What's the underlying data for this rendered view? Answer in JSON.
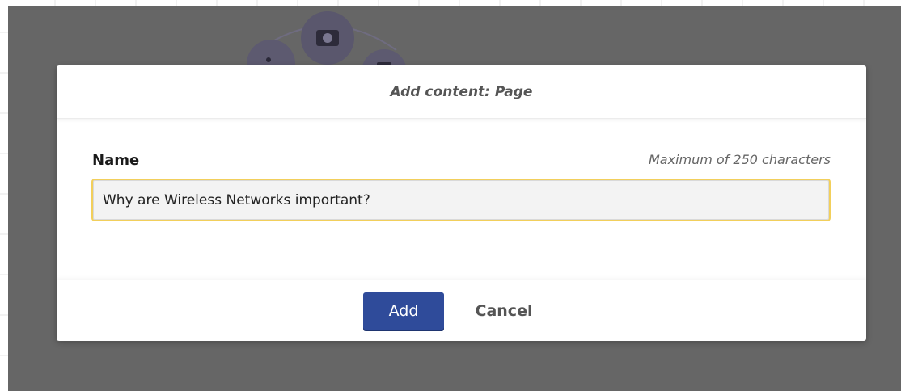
{
  "dialog": {
    "title": "Add content: Page",
    "field_label": "Name",
    "field_hint": "Maximum of 250 characters",
    "name_value": "Why are Wireless Networks important?",
    "add_label": "Add",
    "cancel_label": "Cancel"
  },
  "colors": {
    "overlay": "#666666",
    "primary_button": "#2f4b9a",
    "input_focus_border": "#f2cf5b"
  },
  "icons": {
    "background_illustration": [
      "video-icon",
      "node-icon"
    ]
  }
}
